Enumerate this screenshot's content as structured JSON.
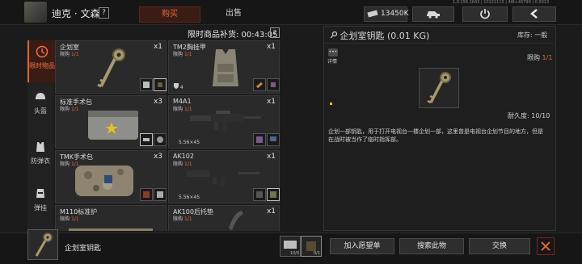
{
  "header": {
    "player_name": "迪克 · 文森",
    "help": "?",
    "tabs": [
      {
        "label": "购买",
        "active": true
      },
      {
        "label": "出售",
        "active": false
      }
    ],
    "money": "13450K",
    "version_text": "1.0.156.1643 | 10121115 | 4f6+45790 | 0.0013",
    "icons": [
      "vehicle-icon",
      "power-icon",
      "back-arrow-icon"
    ]
  },
  "categories": [
    {
      "label": "限时物品",
      "icon": "clock-icon",
      "active": true
    },
    {
      "label": "头盔",
      "icon": "helmet-icon"
    },
    {
      "label": "防弹衣",
      "icon": "vest-icon"
    },
    {
      "label": "弹挂",
      "icon": "rig-icon"
    }
  ],
  "restock": {
    "label": "限时商品补货: 00:43:05",
    "help": "?"
  },
  "items": [
    {
      "name": "企划室",
      "limit_label": "限购",
      "limit": "1/1",
      "qty": "x1",
      "img": "key",
      "selected": true
    },
    {
      "name": "TM2胸挂甲",
      "limit_label": "限购",
      "limit": "1/1",
      "qty": "x1",
      "img": "armor",
      "durability": "4"
    },
    {
      "name": "标准手术包",
      "limit_label": "限购",
      "limit": "1/1",
      "qty": "x3",
      "img": "bag"
    },
    {
      "name": "M4A1",
      "limit_label": "限购",
      "limit": "1/1",
      "qty": "x1",
      "img": "rifle",
      "ammo": "5.56×45"
    },
    {
      "name": "TMK手术包",
      "limit_label": "限购",
      "limit": "1/1",
      "qty": "x3",
      "img": "camo-bag"
    },
    {
      "name": "AK102",
      "limit_label": "限购",
      "limit": "1/1",
      "qty": "x1",
      "img": "ak",
      "ammo": "5.56×45"
    },
    {
      "name": "M110标准护",
      "limit_label": "限购",
      "limit": "1/1",
      "qty": "",
      "img": "rail"
    },
    {
      "name": "AK100后托垫",
      "limit_label": "限购",
      "limit": "1/1",
      "qty": "x1",
      "img": "pad"
    }
  ],
  "detail": {
    "title": "企划室钥匙 (0.01 KG)",
    "stock": "库存: 一般",
    "info_label": "详情",
    "limit_label": "限购",
    "limit": "1/1",
    "durability": "耐久度: 10/10",
    "description": "企划一部钥匙，用于打开电视台一楼企划一部，这里曾是电视台企划节目的地方，但是在战时被当作了临时指挥部。"
  },
  "bottom": {
    "selected_name": "企划室钥匙",
    "slots": [
      {
        "count": "10/0"
      },
      {
        "count": "0/1"
      }
    ],
    "buttons": [
      "加入愿望单",
      "搜索此物",
      "交换"
    ]
  },
  "colors": {
    "accent": "#e0662e",
    "panel": "#2a2a2a",
    "background": "#1b1b1b"
  }
}
